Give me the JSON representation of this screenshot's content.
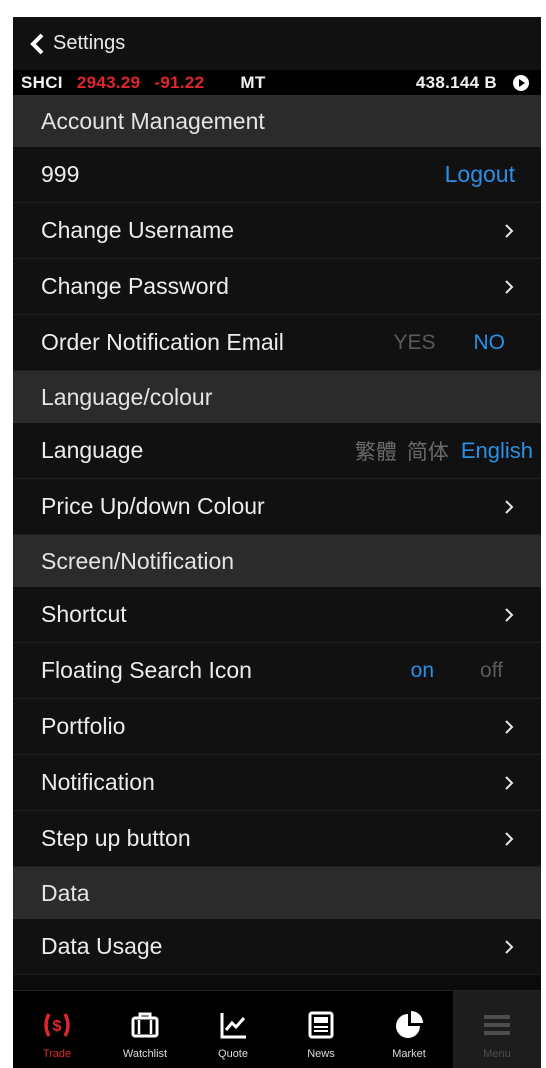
{
  "header": {
    "back_label": "Settings"
  },
  "ticker": {
    "symbol": "SHCI",
    "price": "2943.29",
    "change": "-91.22",
    "market": "MT",
    "volume": "438.144 B"
  },
  "sections": {
    "account": "Account Management",
    "language": "Language/colour",
    "screen": "Screen/Notification",
    "data": "Data"
  },
  "account": {
    "user_id": "999",
    "logout": "Logout",
    "change_username": "Change Username",
    "change_password": "Change Password",
    "order_email": "Order Notification Email",
    "email_yes": "YES",
    "email_no": "NO"
  },
  "language": {
    "label": "Language",
    "traditional": "繁體",
    "simplified": "简体",
    "english": "English",
    "price_colour": "Price Up/down Colour"
  },
  "screen": {
    "shortcut": "Shortcut",
    "floating_search": "Floating Search Icon",
    "on": "on",
    "off": "off",
    "portfolio": "Portfolio",
    "notification": "Notification",
    "step_up": "Step up button"
  },
  "data": {
    "usage": "Data Usage"
  },
  "tabs": {
    "trade": "Trade",
    "watchlist": "Watchlist",
    "quote": "Quote",
    "news": "News",
    "market": "Market",
    "menu": "Menu"
  },
  "colors": {
    "accent": "#2a8fe6",
    "down": "#e0262b",
    "background": "#0b0b0b",
    "section": "#2b2b2b"
  }
}
